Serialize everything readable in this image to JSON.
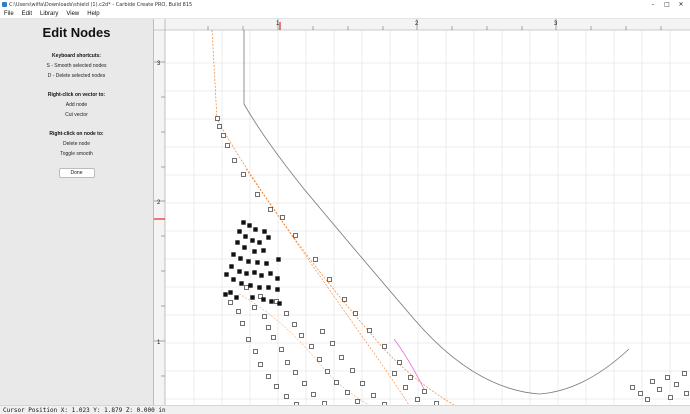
{
  "window": {
    "title": "C:\\Users\\wilfa\\Downloads\\shield (1).c2d* - Carbide Create PRO, Build 815",
    "controls": [
      "–",
      "□",
      "✕"
    ]
  },
  "menu": {
    "items": [
      "File",
      "Edit",
      "Library",
      "View",
      "Help"
    ]
  },
  "sidebar": {
    "heading": "Edit Nodes",
    "shortcuts_title": "Keyboard shortcuts:",
    "shortcuts": [
      "S - Smooth selected nodes",
      "D - Delete selected nodes"
    ],
    "vector_title": "Right-click on vector to:",
    "vector_actions": [
      "Add node",
      "Cut vector"
    ],
    "node_title": "Right-click on node to:",
    "node_actions": [
      "Delete node",
      "Toggle smooth"
    ],
    "done_label": "Done"
  },
  "ruler": {
    "top_labels": [
      "1",
      "2",
      "3"
    ],
    "left_labels": [
      "3",
      "2",
      "1"
    ]
  },
  "status": {
    "text": "Cursor Position X: 1.023 Y: 1.879 Z: 0.000 in"
  }
}
